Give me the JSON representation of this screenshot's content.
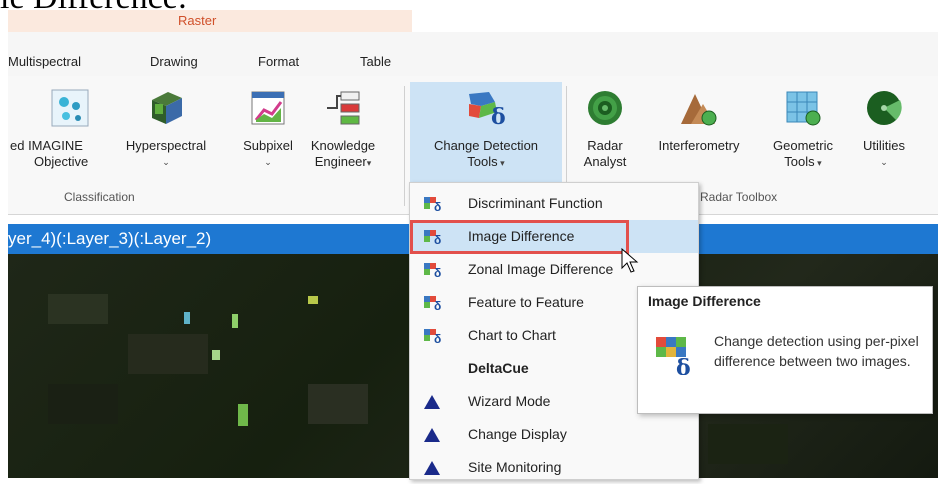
{
  "doc_heading": "le Difference:",
  "context_tab": "Raster",
  "tabs": [
    "Multispectral",
    "Drawing",
    "Format",
    "Table"
  ],
  "ribbon": {
    "classification_group": "Classification",
    "radar_group": "Radar Toolbox",
    "buttons": {
      "imagine_objective": [
        "ed IMAGINE",
        "Objective"
      ],
      "hyperspectral": "Hyperspectral",
      "subpixel": "Subpixel",
      "knowledge_engineer": [
        "Knowledge",
        "Engineer"
      ],
      "change_detection": [
        "Change Detection",
        "Tools"
      ],
      "radar_analyst": [
        "Radar",
        "Analyst"
      ],
      "interferometry": "Interferometry",
      "geometric_tools": [
        "Geometric",
        "Tools"
      ],
      "utilities": "Utilities"
    }
  },
  "view_title": "yer_4)(:Layer_3)(:Layer_2)",
  "menu": {
    "items": [
      {
        "label": "Discriminant Function",
        "icon": "change-detection-icon"
      },
      {
        "label": "Image Difference",
        "icon": "change-detection-icon"
      },
      {
        "label": "Zonal Image Difference",
        "icon": "change-detection-icon"
      },
      {
        "label": "Feature to Feature",
        "icon": "change-detection-icon"
      },
      {
        "label": "Chart to Chart",
        "icon": "change-detection-icon"
      },
      {
        "label": "DeltaCue",
        "icon": ""
      },
      {
        "label": "Wizard Mode",
        "icon": "triangle-icon"
      },
      {
        "label": "Change Display",
        "icon": "triangle-icon"
      },
      {
        "label": "Site Monitoring",
        "icon": "triangle-icon"
      }
    ]
  },
  "tooltip": {
    "title": "Image Difference",
    "body": "Change detection using per-pixel difference between two images."
  },
  "colors": {
    "title_bar": "#1e78d2",
    "menu_highlight": "#cde3f5",
    "highlight_box": "#e2504c",
    "raster_context": "#d0502a"
  }
}
